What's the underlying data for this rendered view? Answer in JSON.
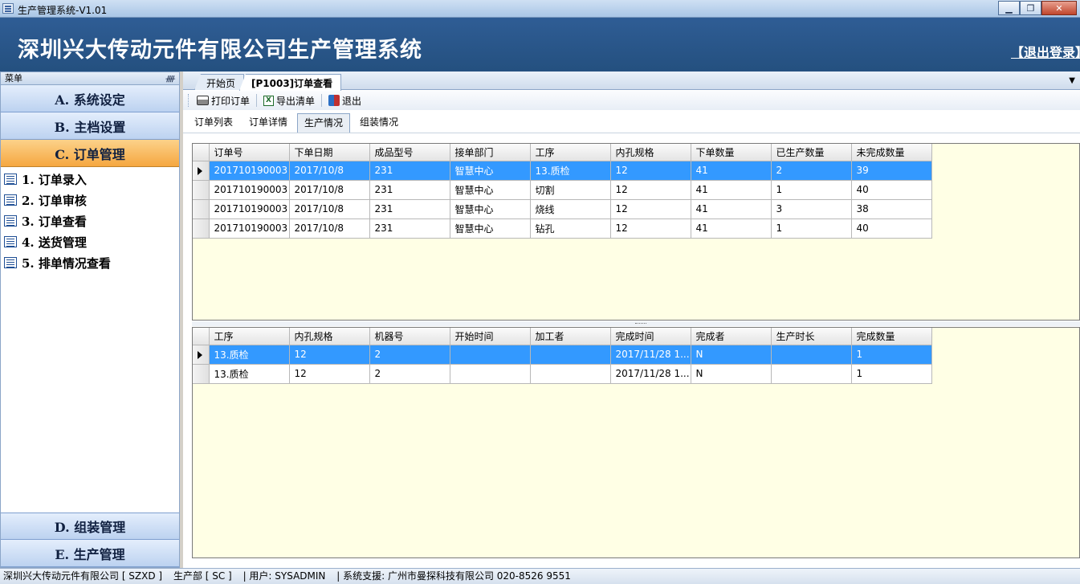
{
  "window": {
    "title": "生产管理系统-V1.01"
  },
  "header": {
    "system_title": "深圳兴大传动元件有限公司生产管理系统",
    "logout": "【退出登录】"
  },
  "menu": {
    "header": "菜单",
    "groups_top": [
      "A. 系统设定",
      "B. 主档设置",
      "C. 订单管理"
    ],
    "items": [
      "1. 订单录入",
      "2. 订单审核",
      "3. 订单查看",
      "4. 送货管理",
      "5. 排单情况查看"
    ],
    "groups_bottom": [
      "D. 组装管理",
      "E. 生产管理"
    ]
  },
  "doc_tabs": [
    "开始页",
    "[P1003]订单查看"
  ],
  "toolbar": {
    "print": "打印订单",
    "export": "导出清单",
    "exit": "退出"
  },
  "sub_tabs": [
    "订单列表",
    "订单详情",
    "生产情况",
    "组装情况"
  ],
  "orders_grid": {
    "columns": [
      "订单号",
      "下单日期",
      "成品型号",
      "接单部门",
      "工序",
      "内孔规格",
      "下单数量",
      "已生产数量",
      "未完成数量"
    ],
    "rows": [
      [
        "201710190003",
        "2017/10/8",
        "231",
        "智慧中心",
        "13.质检",
        "12",
        "41",
        "2",
        "39"
      ],
      [
        "201710190003",
        "2017/10/8",
        "231",
        "智慧中心",
        "切割",
        "12",
        "41",
        "1",
        "40"
      ],
      [
        "201710190003",
        "2017/10/8",
        "231",
        "智慧中心",
        "烧线",
        "12",
        "41",
        "3",
        "38"
      ],
      [
        "201710190003",
        "2017/10/8",
        "231",
        "智慧中心",
        "钻孔",
        "12",
        "41",
        "1",
        "40"
      ]
    ]
  },
  "process_grid": {
    "columns": [
      "工序",
      "内孔规格",
      "机器号",
      "开始时间",
      "加工者",
      "完成时间",
      "完成者",
      "生产时长",
      "完成数量"
    ],
    "rows": [
      [
        "13.质检",
        "12",
        "2",
        "",
        "",
        "2017/11/28 1...",
        "N",
        "",
        "1"
      ],
      [
        "13.质检",
        "12",
        "2",
        "",
        "",
        "2017/11/28 1...",
        "N",
        "",
        "1"
      ]
    ]
  },
  "statusbar": {
    "company": "深圳兴大传动元件有限公司 [ SZXD ]",
    "dept": "生产部 [ SC ]",
    "user": "|   用户: SYSADMIN",
    "support": "|   系统支援: 广州市曼探科技有限公司 020-8526 9551"
  }
}
